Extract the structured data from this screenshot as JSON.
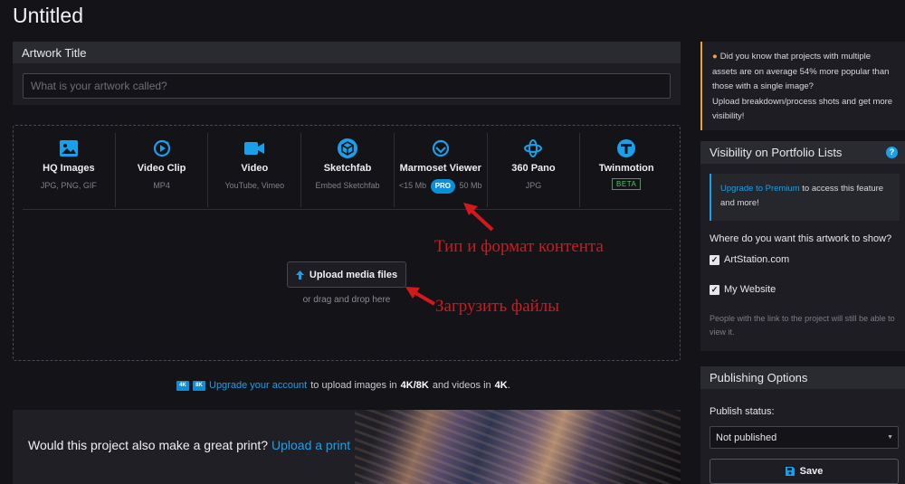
{
  "page": {
    "title": "Untitled"
  },
  "artwork": {
    "header": "Artwork Title",
    "placeholder": "What is your artwork called?"
  },
  "media_types": [
    {
      "name": "HQ Images",
      "formats": "JPG, PNG, GIF",
      "icon": "image-icon"
    },
    {
      "name": "Video Clip",
      "formats": "MP4",
      "icon": "video-clip-icon"
    },
    {
      "name": "Video",
      "formats": "YouTube, Vimeo",
      "icon": "video-camera-icon"
    },
    {
      "name": "Sketchfab",
      "formats": "Embed Sketchfab",
      "icon": "sketchfab-icon"
    },
    {
      "name": "Marmoset Viewer",
      "formats_before": "<15 Mb",
      "badge": "PRO",
      "formats_after": "50 Mb",
      "icon": "marmoset-icon"
    },
    {
      "name": "360 Pano",
      "formats": "JPG",
      "icon": "pano-360-icon"
    },
    {
      "name": "Twinmotion",
      "badge": "BETA",
      "icon": "twinmotion-icon"
    }
  ],
  "upload": {
    "button_label": "Upload media files",
    "drag_text": "or drag and drop here"
  },
  "annotations": {
    "content_type": "Тип и формат контента",
    "upload_files": "Загрузить файлы"
  },
  "upgrade": {
    "badge_4k": "4K",
    "badge_8k": "8K",
    "link": "Upgrade your account",
    "text1": "to upload images in",
    "res": "4K/8K",
    "text2": "and videos in",
    "res2": "4K",
    "end": "."
  },
  "print": {
    "question": "Would this project also make a great print?",
    "link": "Upload a print"
  },
  "tip": {
    "text": "Did you know that projects with multiple assets are on average 54% more popular than those with a single image?",
    "text2": "Upload breakdown/process shots and get more visibility!"
  },
  "visibility": {
    "header": "Visibility on Portfolio Lists",
    "help": "?",
    "premium_link": "Upgrade to Premium",
    "premium_text": "to access this feature and more!",
    "question": "Where do you want this artwork to show?",
    "options": [
      {
        "label": "ArtStation.com",
        "checked": true
      },
      {
        "label": "My Website",
        "checked": true
      }
    ],
    "note": "People with the link to the project will still be able to view it."
  },
  "publishing": {
    "header": "Publishing Options",
    "status_label": "Publish status:",
    "status_value": "Not published",
    "save_label": "Save"
  },
  "colors": {
    "accent": "#1aa0ea",
    "pro_badge": "#0b8fd9",
    "beta": "#55c46a",
    "tip_border": "#e8a33c",
    "annotation": "#d4181c"
  }
}
